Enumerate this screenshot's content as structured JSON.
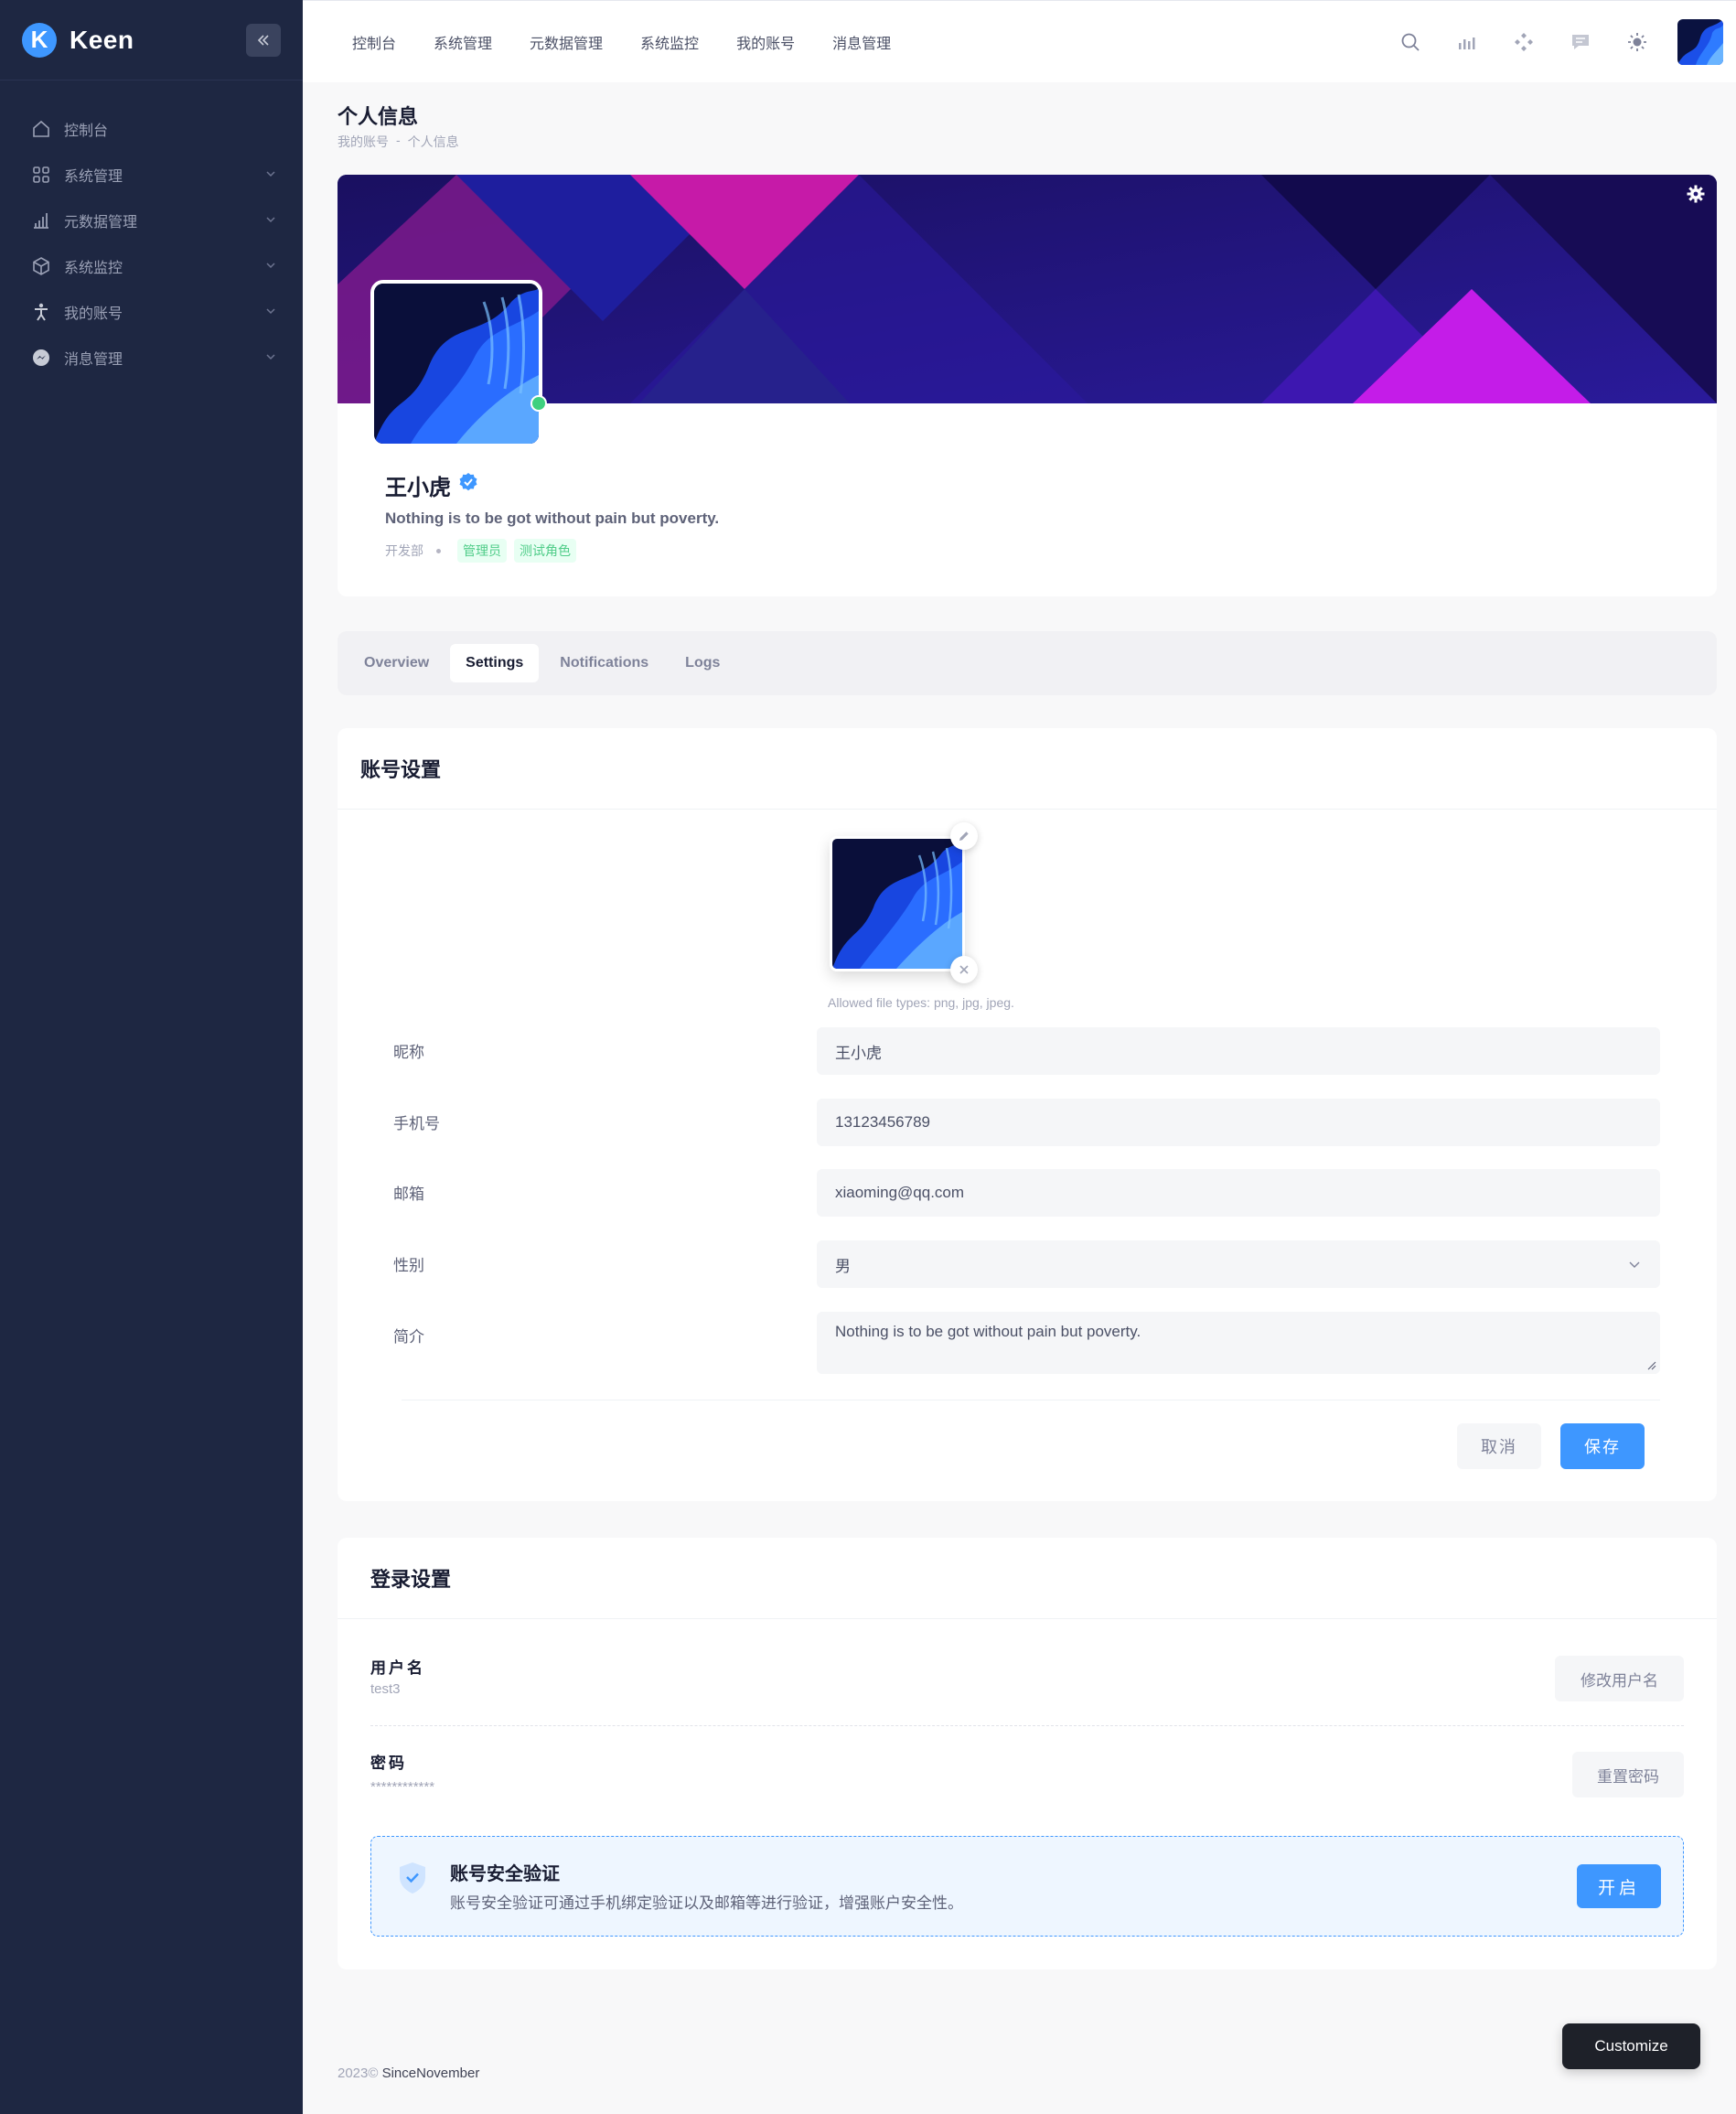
{
  "app": {
    "logo_letter": "K",
    "name": "Keen"
  },
  "sidebar": {
    "items": [
      {
        "label": "控制台",
        "icon": "home-icon",
        "expandable": false
      },
      {
        "label": "系统管理",
        "icon": "grid-icon",
        "expandable": true
      },
      {
        "label": "元数据管理",
        "icon": "bar-chart-icon",
        "expandable": true
      },
      {
        "label": "系统监控",
        "icon": "cube-icon",
        "expandable": true
      },
      {
        "label": "我的账号",
        "icon": "person-icon",
        "expandable": true
      },
      {
        "label": "消息管理",
        "icon": "messenger-icon",
        "expandable": true
      }
    ]
  },
  "topnav": [
    "控制台",
    "系统管理",
    "元数据管理",
    "系统监控",
    "我的账号",
    "消息管理"
  ],
  "page": {
    "title": "个人信息",
    "breadcrumb": [
      "我的账号",
      "-",
      "个人信息"
    ]
  },
  "profile": {
    "name": "王小虎",
    "bio": "Nothing is to be got without pain but poverty.",
    "department": "开发部",
    "roles": [
      "管理员",
      "测试角色"
    ],
    "status": "online"
  },
  "tabs": [
    {
      "label": "Overview",
      "active": false
    },
    {
      "label": "Settings",
      "active": true
    },
    {
      "label": "Notifications",
      "active": false
    },
    {
      "label": "Logs",
      "active": false
    }
  ],
  "account_settings": {
    "title": "账号设置",
    "allowed_types": "Allowed file types: png, jpg, jpeg.",
    "fields": {
      "nickname": {
        "label": "昵称",
        "value": "王小虎"
      },
      "phone": {
        "label": "手机号",
        "value": "13123456789"
      },
      "email": {
        "label": "邮箱",
        "value": "xiaoming@qq.com"
      },
      "gender": {
        "label": "性别",
        "value": "男"
      },
      "intro": {
        "label": "简介",
        "value": "Nothing is to be got without pain but poverty."
      }
    },
    "cancel_label": "取消",
    "save_label": "保存"
  },
  "login_settings": {
    "title": "登录设置",
    "username_label": "用户名",
    "username_value": "test3",
    "change_username_label": "修改用户名",
    "password_label": "密码",
    "password_value": "************",
    "reset_password_label": "重置密码",
    "security": {
      "title": "账号安全验证",
      "description": "账号安全验证可通过手机绑定验证以及邮箱等进行验证，增强账户安全性。",
      "enable_label": "开启"
    }
  },
  "footer": {
    "year": "2023©",
    "brand": "SinceNovember"
  },
  "customize_label": "Customize",
  "colors": {
    "sidebar_bg": "#1e2742",
    "primary": "#3e97ff",
    "success": "#50cd89",
    "banner": "#231a72"
  }
}
